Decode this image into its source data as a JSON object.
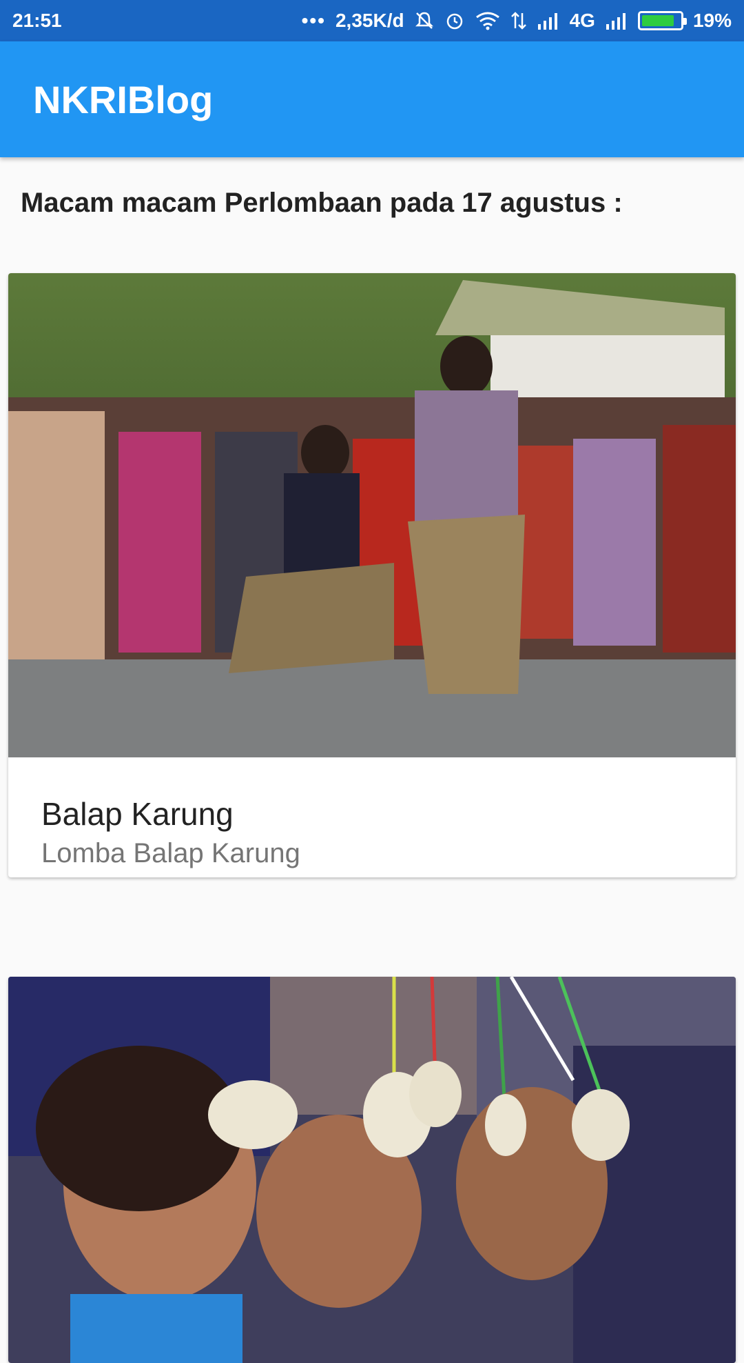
{
  "status_bar": {
    "time": "21:51",
    "network_speed": "2,35K/d",
    "network_type": "4G",
    "battery_percent": "19%",
    "battery_level": 0.19,
    "icons": [
      "more-icon",
      "mute-bell-icon",
      "alarm-icon",
      "wifi-icon",
      "data-arrows-icon",
      "signal-icon",
      "signal-icon-2",
      "battery-icon"
    ]
  },
  "app_bar": {
    "title": "NKRIBlog",
    "color": "#2196f3"
  },
  "heading": "Macam macam Perlombaan pada 17 agustus :",
  "cards": [
    {
      "title": "Balap Karung",
      "subtitle": "Lomba Balap Karung",
      "image": "sack-race-photo"
    },
    {
      "title": "",
      "subtitle": "",
      "image": "cracker-eating-contest-photo"
    }
  ],
  "colors": {
    "status_bar": "#1a66c2",
    "app_bar": "#2196f3",
    "background": "#fafafa",
    "subtitle": "#757575"
  }
}
